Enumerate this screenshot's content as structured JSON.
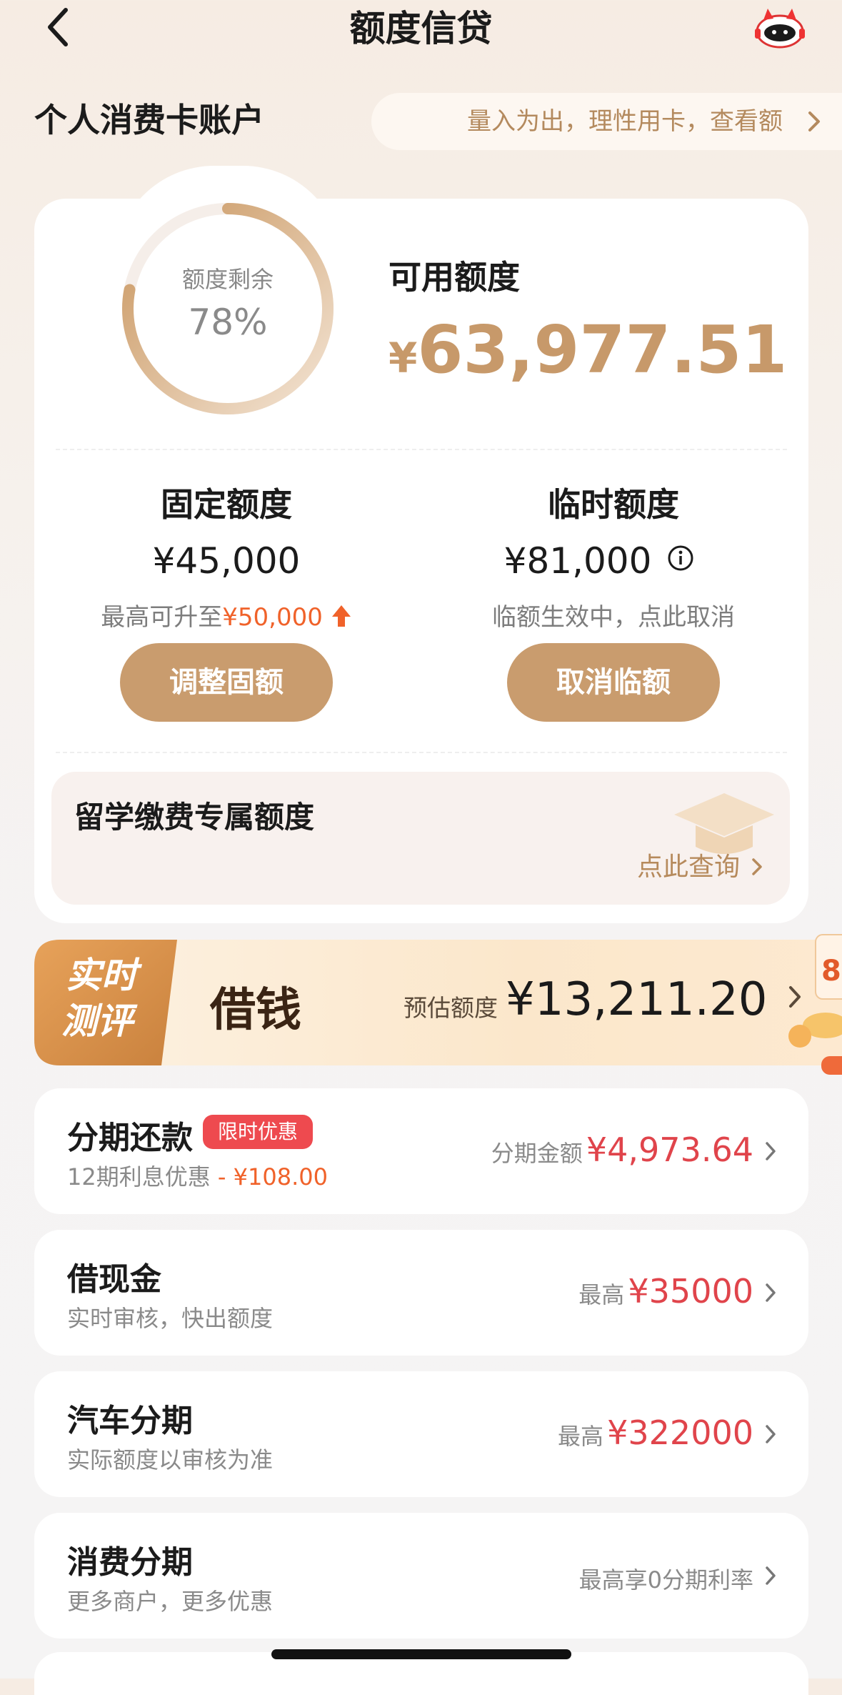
{
  "header": {
    "title": "额度信贷"
  },
  "account": {
    "title": "个人消费卡账户",
    "tip": "量入为出，理性用卡，查看额"
  },
  "quota": {
    "ring_label": "额度剩余",
    "ring_percent_text": "78%",
    "remaining_fraction": 0.78,
    "available_label": "可用额度",
    "available_currency": "¥",
    "available_amount": "63,977.51"
  },
  "fixed": {
    "title": "固定额度",
    "amount": "¥45,000",
    "sub_prefix": "最高可升至",
    "sub_value": "¥50,000",
    "button": "调整固额"
  },
  "temporary": {
    "title": "临时额度",
    "amount": "¥81,000",
    "sub": "临额生效中，点此取消",
    "button": "取消临额"
  },
  "study": {
    "title": "留学缴费专属额度",
    "link": "点此查询"
  },
  "borrow": {
    "badge_line1": "实时",
    "badge_line2": "测评",
    "title": "借钱",
    "est_label": "预估额度",
    "est_amount": "¥13,211.20",
    "deco_text": "8"
  },
  "rows": [
    {
      "title": "分期还款",
      "badge": "限时优惠",
      "sub": "12期利息优惠",
      "sub_highlight": "- ¥108.00",
      "right_label": "分期金额",
      "right_value": "¥4,973.64"
    },
    {
      "title": "借现金",
      "sub": "实时审核，快出额度",
      "right_label": "最高",
      "right_value": "¥35000"
    },
    {
      "title": "汽车分期",
      "sub": "实际额度以审核为准",
      "right_label": "最高",
      "right_value": "¥322000"
    },
    {
      "title": "消费分期",
      "sub": "更多商户，更多优惠",
      "right_label": "最高享0分期利率",
      "right_value": ""
    }
  ],
  "colors": {
    "accent_gold": "#c99c6e",
    "amount_red": "#e0444b",
    "highlight_orange": "#f0622a"
  }
}
